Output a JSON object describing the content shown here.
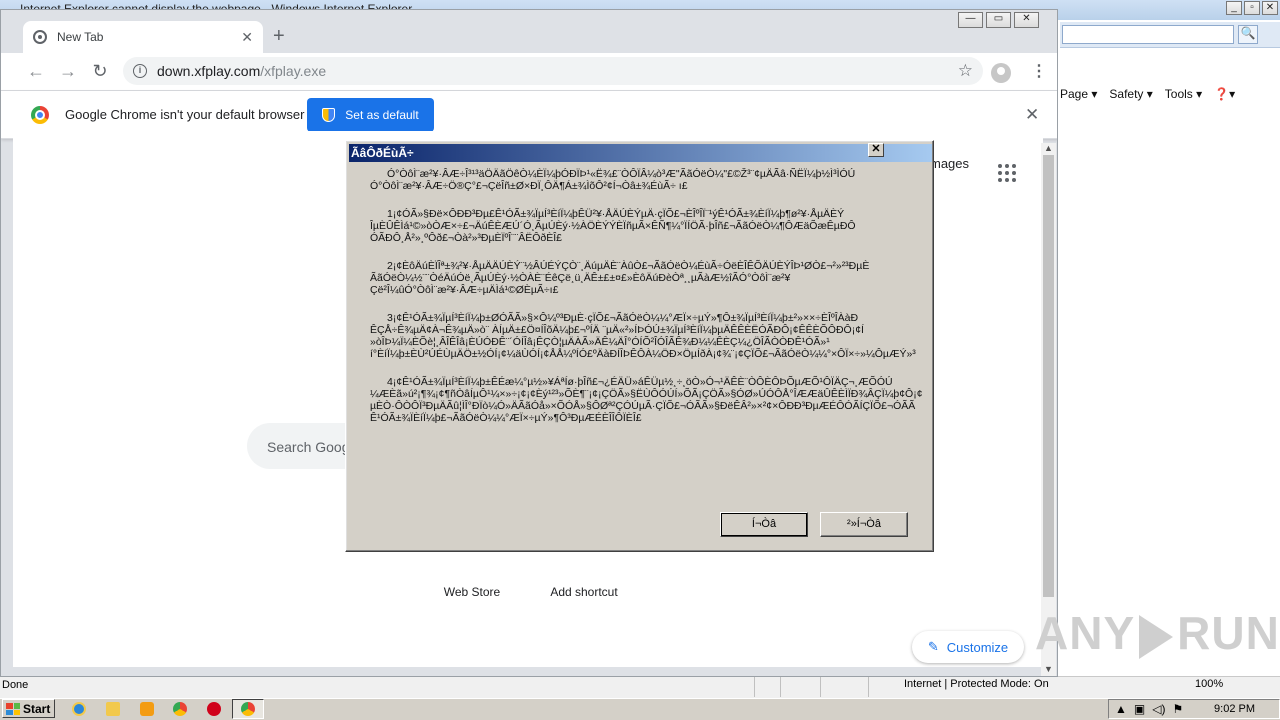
{
  "ie": {
    "title": "Internet Explorer cannot display the webpage - Windows Internet Explorer",
    "caption_minimize": "_",
    "caption_maximize": "▫",
    "caption_close": "✕",
    "search_icon": "search-icon",
    "commands": {
      "page": "Page ▾",
      "safety": "Safety ▾",
      "tools": "Tools ▾",
      "help": "❓▾"
    },
    "status": {
      "left": "Done",
      "zone": "Internet | Protected Mode: On",
      "zoom": "100%"
    }
  },
  "chrome": {
    "tab_title": "New Tab",
    "tab_close": "✕",
    "new_tab": "+",
    "caption_minimize": "—",
    "caption_maximize": "▭",
    "caption_close": "✕",
    "nav": {
      "back": "←",
      "forward": "→",
      "reload": "↻"
    },
    "url_host": "down.xfplay.com",
    "url_path": "/xfplay.exe",
    "bookmark_star": "☆",
    "menu": "⋮",
    "infobar_text": "Google Chrome isn't your default browser",
    "infobar_button": "Set as default",
    "infobar_close": "✕",
    "ntp": {
      "images": "mages",
      "search_placeholder": "Search Goog",
      "shortcut_web_store": "Web Store",
      "shortcut_add": "Add shortcut",
      "customize": "Customize",
      "customize_icon": "✎"
    },
    "scroll_up": "▲",
    "scroll_down": "▼",
    "watermark": "ANY",
    "watermark2": "RUN"
  },
  "dialog": {
    "title": "ÃâÔðÉùÃ÷",
    "close": "✕",
    "paragraphs": [
      [
        "Ó°ÒôÌ¨æ²¥·ÂÆ÷Î³¹³äÖÄãÖêÒ¼ÈÏ¼þÓÐÏÞ¹«Ë¾£¨ÒÔÏÂ¼ò³Æ\"ÃãÓëÒ¼\"£©Ž³¨¢µÄÃâ·ÑËÏ¼þ½Ì³ÌÓÚ",
        "Ó°ÒôÌ¨æ²¥·ÂÆ÷Ö®Ç°£¬ÇëÎñ±Ø×ÐÏ¸ÔÄ¶Á±¾ÌõÔ²¢Í¬Òâ±¾ÉùÃ÷ ı£"
      ],
      [
        "1¡¢ÓÃ»§Ðë×ÔÐÐ³Ðµ£Ê¹ÓÃ±¾ÏµÍ³ÈíÏ¼þÊÜ²¥·ÅÄÚÈÝµÄ·çÏÕ£¬ÈÎºÎÏ¨¹ýÊ¹ÓÃ±¾ÈíÏ¼þ¶ø²¥·ÅµÄÈÝ",
        "ÎµÈÛÊÌá¹©»òÒÆ×÷£¬ÄúÊÈÆÚ´Ó¸ÃµÚÈý·½ÀÖÈÝÝÈÏñµÃ×ÊÑ¶¼°ÏÍÖÃ·þÎñ£¬ÃãÓëÒ¼¶ÔÆäÕæÊµÐÔ",
        "ÓÃÐÔ¸Å²»¸ºÔð£¬Òà²»³ÐµÈÏºÎ¨¨ÂËÔðÈÎ£"
      ],
      [
        "2¡¢ÈôÄúÈÏÎª±¾²¥·ÅµÄÄÚÈÝ¨½ÂÚÉÝÇÒ¨¸ÄúµÄÈ¨ÀûÒ£¬ÃãÓëÒ¼ÉùÃ÷ÓëÈÎÊÕÄÚÈÝÎÞ¹ØÒ£¬²»²³ÐµÈ",
        "ÃãÓëÒ¼½¨¨ÒéÄúÓë¸ÃµÚÈý·½ÒÀÈ¨ÉêÇë¸ü¸ÄÊ±£±¤£»ÈôÄúÐèÒª¸¸µÃàÆ½îÃÓ°ÒôÌ¨æ²¥",
        "Çë²Î¼ûÓ°ÒôÌ¨æ²¥·ÂÆ÷µÄÌá¹©ØÈµÃ÷ı£"
      ],
      [
        "3¡¢Ê¹ÓÃ±¾ÏµÍ³ÈíÏ¼þ±ØÓÃÃ»§×Ô¼º³ÐµÈ·çÏÕ£¬ÃãÓëÒ¼¼°ÆÏ×÷µÝ»¶Ô±¾ÏµÍ³ÈíÏ¼þ±²»××÷ÈÎºÎÀàÐ",
        "ÊÇÅ÷Ê¾µÄ¢À¬Ê¾µÄ»ò¨ ÀÍµÄ±£Ö¤ÍÎõÄ¼þ£¬ºÍÄ ¨µÄ«²»ÍÞÓÚ±¾ÏµÍ³ÈíÏ¼þµÄÊÊÈËÓÃÐÔ¡¢ÊÊÈÕÔÐÔ¡¢Í",
        "»òÎÞ¼Ï¼ÈÕè¦¸ÂÎÊÎâ¡ÈÚÓÐÊ¨´ÓÍÎâ¡ÊÇÒ¦µÄÀÃ»ÄÊ¼ÄÎ°ÓÍÕ²ÎÓÎÃÊ¾Ð¼¼ÊÈÇ¼¿ÖÎÃÒÒÐÊ¹ÓÃ»¹",
        "í°ÈíÏ¼þ±ÈÙ²ÚÉÙµÄÖ±½ÓÍ¡¢¼äÙÓÍ¡¢ÅÅ¼ºÍÓ£ºÄàÐÍÎÞÊÔÀ¼ÖÐ×ÖµÍðÀ¡¢¾¨¡¢ÇÏÕ£¬ÃãÓëÒ¼¼°×ÔÏ×÷»¼ÔµÆÝ»³"
      ],
      [
        "4¡¢Ê¹ÓÃ±¾ÏµÍ³ÈíÏ¼þ±ÊÉæ¼°µ½»¥ÁªÍø·þÎñ£¬¿ÉÄÜ»áÊÜµ½¸÷¸öÒ»Ó¬¹ÄÊÈ¨ÒÔÈÔÞÕµÆÕ¹ÔÏÄÇ¬¸ÆÕÓÚ",
        "¼ÆÈã»ú²¡¶¾¡¢¶ñÒâÍµÔ¹¼×»÷¡¢¡¢Èý¹²³»ÕÈ¶¨¡¢¡ÇÖÃ»§ËÙÔÓÚÍ»ÕÃ¡ÇÖÃ»§ÓØ»ÚÓÔÅ°ÎÆÆäÛÊÈÌÏÐ¾ÂÇÏ¼þ¢Ô¡¢",
        "µÈÒ·ÔÒÔÏ³ÐµÄÃû¦ÌÎ°ÐÏò¼Ó»ÄÃãÓå»×ÕÓÅ»§ÔØª²ÇÓÚµÃ·ÇÏÕ£¬ÓÃÃ»§ÐëÊÂ²»×²¢×ÔÐÐ³ÐµÆÉÔÓÃÍÇÏÕ£¬ÓÃÃ",
        "Ê¹ÓÃ±¾ÏÈíÏ¼þ£¬ÃãÓëÒ¼¼°ÆÏ×÷µÝ»¶Ô³ÐµÆÉÈÎÎÔÏÈÎ£"
      ]
    ],
    "ok": "Í¬Òâ",
    "cancel": "²»Í¬Òâ"
  },
  "taskbar": {
    "start": "Start",
    "clock": "9:02 PM",
    "tray_up": "▲"
  }
}
